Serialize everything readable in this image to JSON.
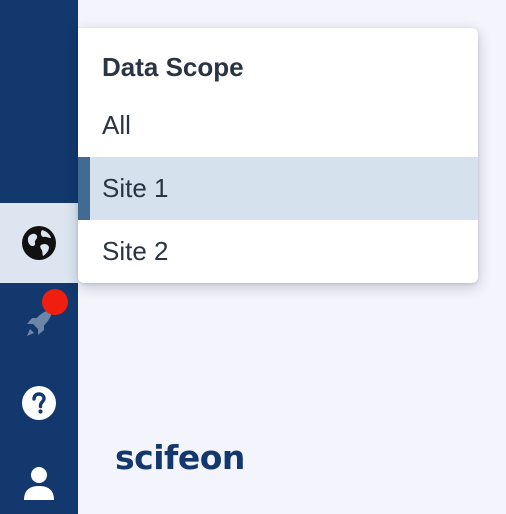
{
  "sidebar": {
    "items": [
      {
        "icon": "globe-icon",
        "active": true
      },
      {
        "icon": "rocket-icon",
        "active": false,
        "notification": true
      },
      {
        "icon": "help-icon",
        "active": false
      },
      {
        "icon": "user-icon",
        "active": false
      }
    ]
  },
  "logo": {
    "text": "scifeon"
  },
  "dropdown": {
    "title": "Data Scope",
    "items": [
      {
        "label": "All"
      },
      {
        "label": "Site 1",
        "selected": true
      },
      {
        "label": "Site 2"
      }
    ]
  },
  "colors": {
    "sidebar_bg": "#12386e",
    "page_bg": "#f4f4fc",
    "selected_bg": "#d5e1ec",
    "selected_accent": "#416b93",
    "notification": "#f01e0e",
    "text": "#2a3444"
  }
}
